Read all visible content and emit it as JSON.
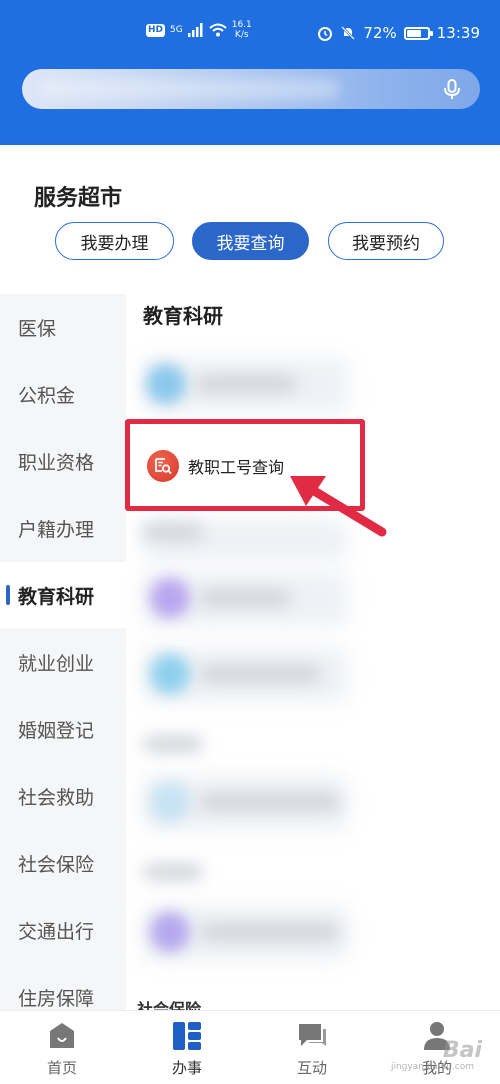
{
  "status_bar": {
    "hd": "HD",
    "signal": "5G",
    "speed_value": "16.1",
    "speed_unit": "K/s",
    "battery": "72%",
    "battery_level": 0.72,
    "time": "13:39"
  },
  "search": {
    "icon": "mic-icon"
  },
  "service": {
    "title": "服务超市",
    "segments": [
      {
        "label": "我要办理",
        "active": false
      },
      {
        "label": "我要查询",
        "active": true
      },
      {
        "label": "我要预约",
        "active": false
      }
    ]
  },
  "sidenav": {
    "items": [
      {
        "label": "医保",
        "active": false
      },
      {
        "label": "公积金",
        "active": false
      },
      {
        "label": "职业资格",
        "active": false
      },
      {
        "label": "户籍办理",
        "active": false
      },
      {
        "label": "教育科研",
        "active": true
      },
      {
        "label": "就业创业",
        "active": false
      },
      {
        "label": "婚姻登记",
        "active": false
      },
      {
        "label": "社会救助",
        "active": false
      },
      {
        "label": "社会保险",
        "active": false
      },
      {
        "label": "交通出行",
        "active": false
      },
      {
        "label": "住房保障",
        "active": false
      }
    ]
  },
  "content": {
    "section_title": "教育科研",
    "highlighted_item": {
      "label": "教职工号查询",
      "icon": "staff-id-search-icon"
    },
    "next_section_peek": "社会保险",
    "colors": {
      "highlight": "#e12b45",
      "accent": "#2b67c9"
    }
  },
  "tabbar": {
    "items": [
      {
        "label": "首页",
        "icon": "home-icon",
        "active": false
      },
      {
        "label": "办事",
        "icon": "services-grid-icon",
        "active": true
      },
      {
        "label": "互动",
        "icon": "chat-icon",
        "active": false
      },
      {
        "label": "我的",
        "icon": "user-icon",
        "active": false
      }
    ]
  },
  "watermark": {
    "text": "Bai",
    "sub": "jingyan.baidu.com"
  }
}
